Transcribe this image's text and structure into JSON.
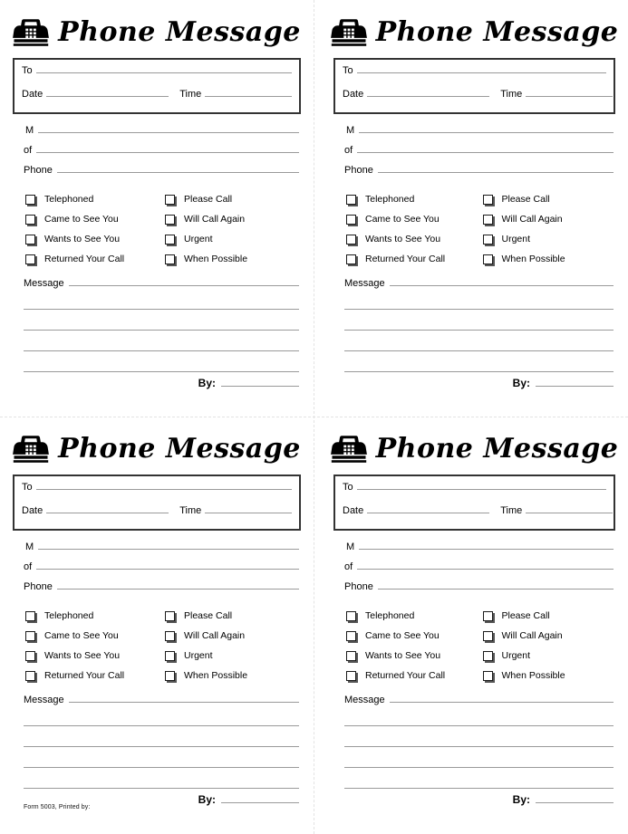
{
  "page": {
    "background_color": "#ffffff",
    "ink_color": "#000000",
    "rule_color": "#9a9a9a",
    "box_border_color": "#333333",
    "cut_guide_color": "#e3e3e3",
    "cut_guides": {
      "vertical_label": "vertical-cut-line",
      "horizontal_label": "horizontal-cut-line"
    }
  },
  "card": {
    "icon": "telephone-icon",
    "title": "Phone Message",
    "to_label": "To",
    "date_label": "Date",
    "time_label": "Time",
    "m_label": "M",
    "of_label": "of",
    "phone_label": "Phone",
    "message_label": "Message",
    "by_label": "By:",
    "message_line_count": 4,
    "checkboxes_left": [
      "Telephoned",
      "Came to See You",
      "Wants to See You",
      "Returned Your Call"
    ],
    "checkboxes_right": [
      "Please Call",
      "Will Call Again",
      "Urgent",
      "When Possible"
    ]
  },
  "footer": {
    "form_id": "Form 5003, Printed by:"
  },
  "cards": [
    {
      "position": "top-left",
      "show_form_id": false
    },
    {
      "position": "top-right",
      "show_form_id": false
    },
    {
      "position": "bottom-left",
      "show_form_id": true
    },
    {
      "position": "bottom-right",
      "show_form_id": false
    }
  ]
}
